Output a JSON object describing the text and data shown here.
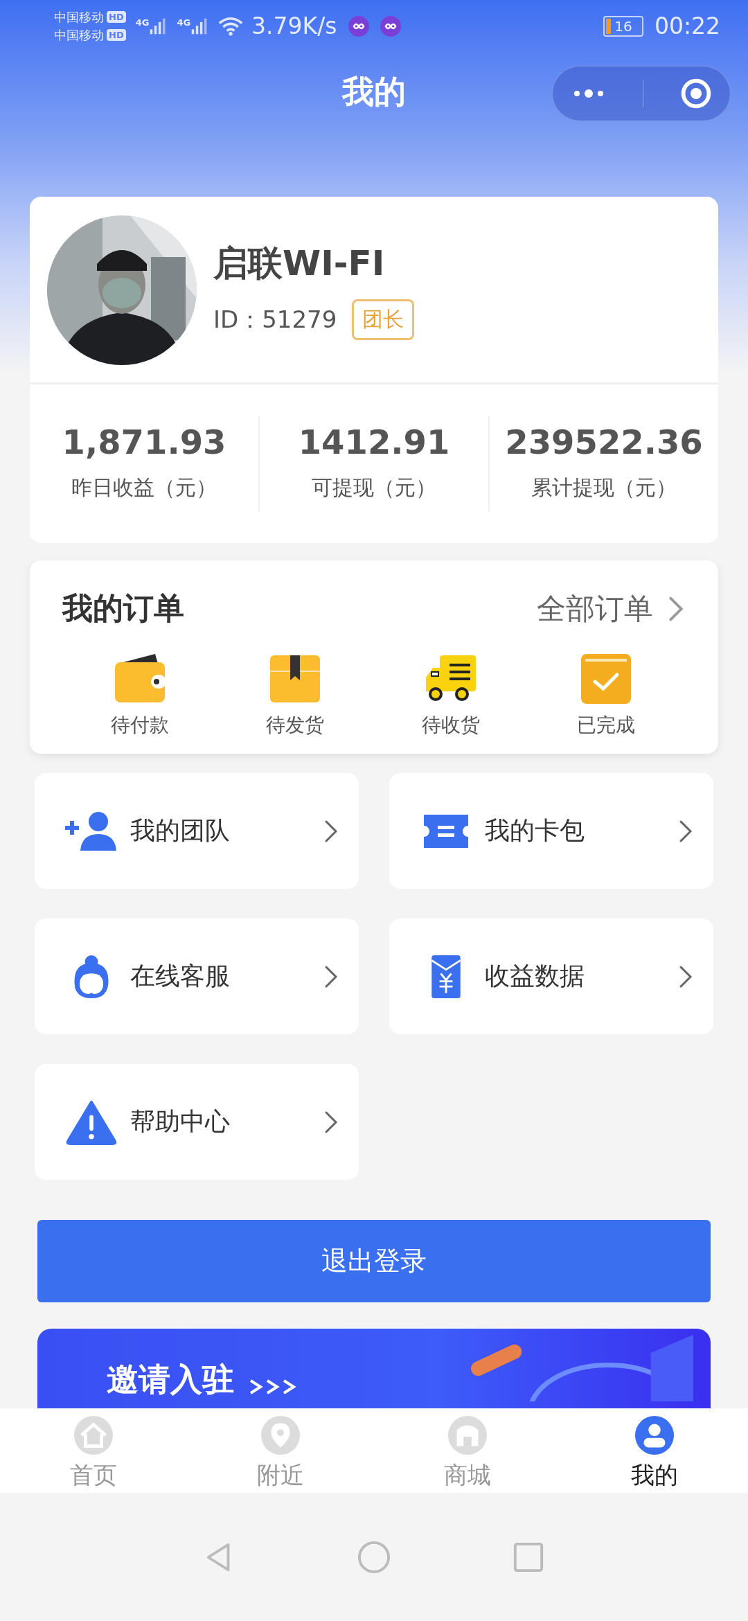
{
  "status_bar": {
    "carriers": [
      {
        "name": "中国移动",
        "badge": "HD"
      },
      {
        "name": "中国移动",
        "badge": "HD"
      }
    ],
    "networks": [
      "4G",
      "4G"
    ],
    "speed": "3.79K/s",
    "battery": "16",
    "time": "00:22"
  },
  "header": {
    "title": "我的"
  },
  "profile": {
    "name": "启联WI-FI",
    "id": "ID：51279",
    "role": "团长"
  },
  "stats": [
    {
      "value": "1,871.93",
      "label": "昨日收益（元）"
    },
    {
      "value": "1412.91",
      "label": "可提现（元）"
    },
    {
      "value": "239522.36",
      "label": "累计提现（元）"
    }
  ],
  "orders": {
    "title": "我的订单",
    "all_link": "全部订单",
    "items": [
      {
        "kind": "wallet",
        "label": "待付款"
      },
      {
        "kind": "box",
        "label": "待发货"
      },
      {
        "kind": "truck",
        "label": "待收货"
      },
      {
        "kind": "done",
        "label": "已完成"
      }
    ]
  },
  "menu": [
    {
      "kind": "team",
      "label": "我的团队"
    },
    {
      "kind": "card",
      "label": "我的卡包"
    },
    {
      "kind": "service",
      "label": "在线客服"
    },
    {
      "kind": "income",
      "label": "收益数据"
    },
    {
      "kind": "help",
      "label": "帮助中心"
    }
  ],
  "logout_button": "退出登录",
  "banner": {
    "title": "邀请入驻"
  },
  "tabs": [
    {
      "kind": "home",
      "label": "首页",
      "selected": false
    },
    {
      "kind": "nearby",
      "label": "附近",
      "selected": false
    },
    {
      "kind": "shop",
      "label": "商城",
      "selected": false
    },
    {
      "kind": "me",
      "label": "我的",
      "selected": true
    }
  ]
}
